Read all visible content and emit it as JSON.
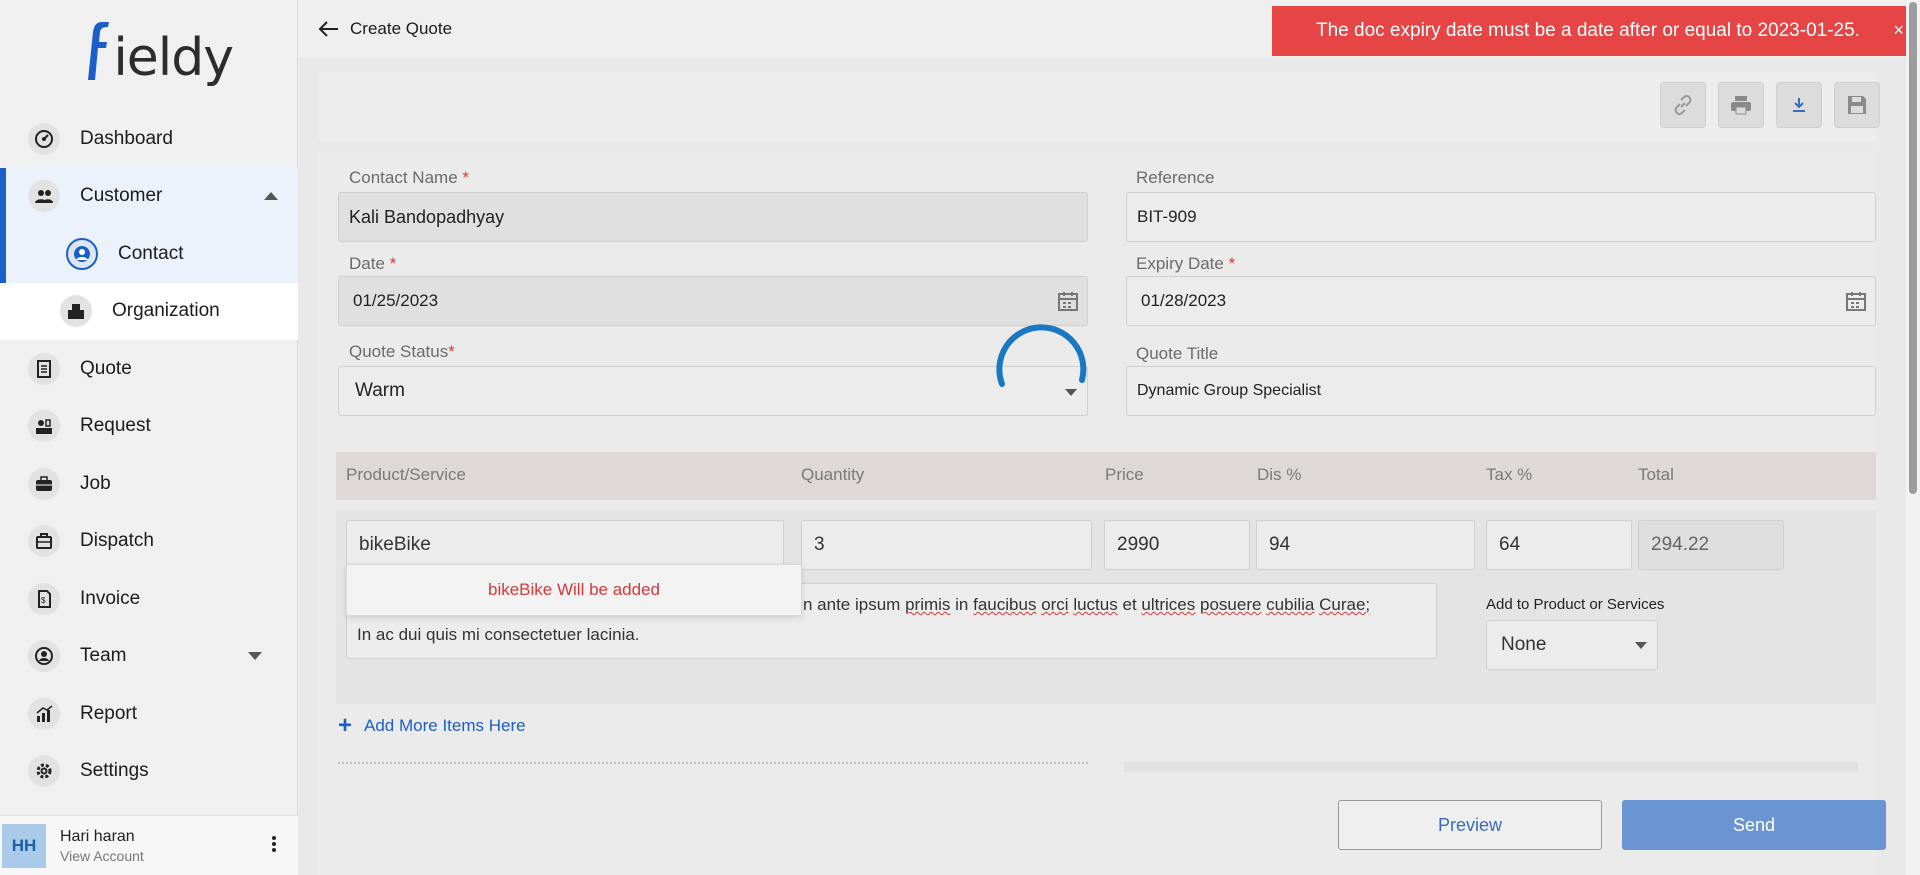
{
  "app": {
    "logo": "fieldy"
  },
  "header": {
    "back_title": "Create Quote"
  },
  "toast": {
    "message": "The doc expiry date must be a date after or equal to 2023-01-25.",
    "close": "×",
    "color": "#e64545"
  },
  "sidebar": {
    "items": [
      {
        "label": "Dashboard",
        "icon": "dashboard-icon"
      },
      {
        "label": "Customer",
        "icon": "users-icon",
        "expanded": true
      },
      {
        "label": "Contact",
        "icon": "contact-icon",
        "active": true
      },
      {
        "label": "Organization",
        "icon": "building-icon"
      },
      {
        "label": "Quote",
        "icon": "quote-icon"
      },
      {
        "label": "Request",
        "icon": "request-icon"
      },
      {
        "label": "Job",
        "icon": "job-icon"
      },
      {
        "label": "Dispatch",
        "icon": "dispatch-icon"
      },
      {
        "label": "Invoice",
        "icon": "invoice-icon"
      },
      {
        "label": "Team",
        "icon": "team-icon"
      },
      {
        "label": "Report",
        "icon": "report-icon"
      },
      {
        "label": "Settings",
        "icon": "settings-icon"
      }
    ],
    "account": {
      "initials": "HH",
      "name": "Hari haran",
      "sub": "View Account"
    }
  },
  "toolbar": {
    "tools": [
      "link-icon",
      "print-icon",
      "download-icon",
      "save-icon"
    ]
  },
  "form": {
    "contact_label": "Contact Name",
    "contact_value": "Kali Bandopadhyay",
    "reference_label": "Reference",
    "reference_value": "BIT-909",
    "date_label": "Date",
    "date_value": "01/25/2023",
    "expiry_label": "Expiry Date",
    "expiry_value": "01/28/2023",
    "status_label": "Quote Status",
    "status_value": "Warm",
    "title_label": "Quote Title",
    "title_value": "Dynamic Group Specialist",
    "required_mark": "*"
  },
  "items": {
    "headers": [
      "Product/Service",
      "Quantity",
      "Price",
      "Dis %",
      "Tax %",
      "Total"
    ],
    "row": {
      "product": "bikeBike",
      "quantity": "3",
      "price": "2990",
      "discount": "94",
      "tax": "64",
      "total": "294.22"
    },
    "suggestion": "bikeBike Will be added",
    "description_prefix": "n ante ipsum",
    "description_words": [
      "primis",
      "in",
      "faucibus",
      "orci",
      "luctus",
      "et",
      "ultrices",
      "posuere",
      "cubilia",
      "Curae;"
    ],
    "description_line2": "In ac dui quis mi consectetuer lacinia.",
    "add_to_label": "Add to Product or Services",
    "add_to_value": "None",
    "add_more": "Add More Items Here",
    "add_more_symbol": "+"
  },
  "actions": {
    "preview": "Preview",
    "send": "Send",
    "accent": "#1c5fc8"
  }
}
